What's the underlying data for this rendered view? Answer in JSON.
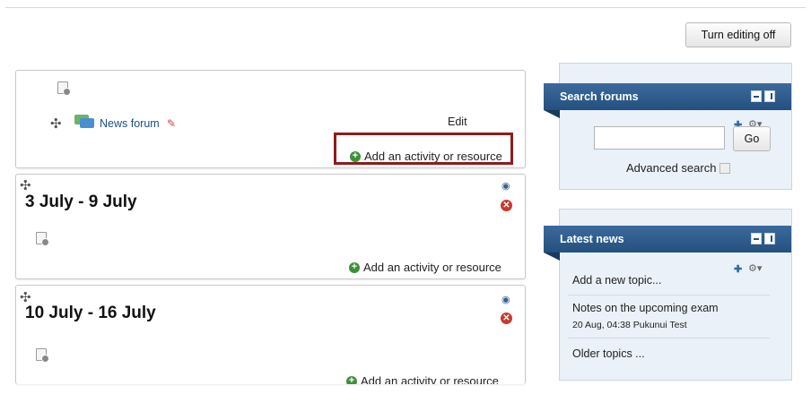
{
  "toolbar": {
    "turn_editing_label": "Turn editing off"
  },
  "sections": [
    {
      "title": "",
      "activity": "News forum",
      "edit_label": "Edit",
      "add_label": "Add an activity or resource"
    },
    {
      "title": "3 July - 9 July",
      "add_label": "Add an activity or resource"
    },
    {
      "title": "10 July - 16 July",
      "add_label": "Add an activity or resource"
    }
  ],
  "search_block": {
    "title": "Search forums",
    "go_label": "Go",
    "input_value": "",
    "advanced_label": "Advanced search"
  },
  "news_block": {
    "title": "Latest news",
    "add_topic": "Add a new topic...",
    "post_title": "Notes on the upcoming exam",
    "post_meta": "20 Aug, 04:38 Pukunui Test",
    "older_label": "Older topics ..."
  },
  "icons": {
    "move": "move-icon",
    "document": "document-icon",
    "forum": "forum-icon",
    "pencil": "pencil-icon",
    "add": "add-icon",
    "eye": "eye-icon",
    "delete": "delete-icon",
    "gear": "gear-icon",
    "crosshair": "move-block-icon",
    "minimize": "minimize-icon",
    "dock": "dock-icon",
    "help": "help-icon"
  },
  "colors": {
    "block_header": "#24507f",
    "highlight": "#8f1b1b",
    "add_green": "#3d8f3a",
    "delete_red": "#c9392c"
  }
}
